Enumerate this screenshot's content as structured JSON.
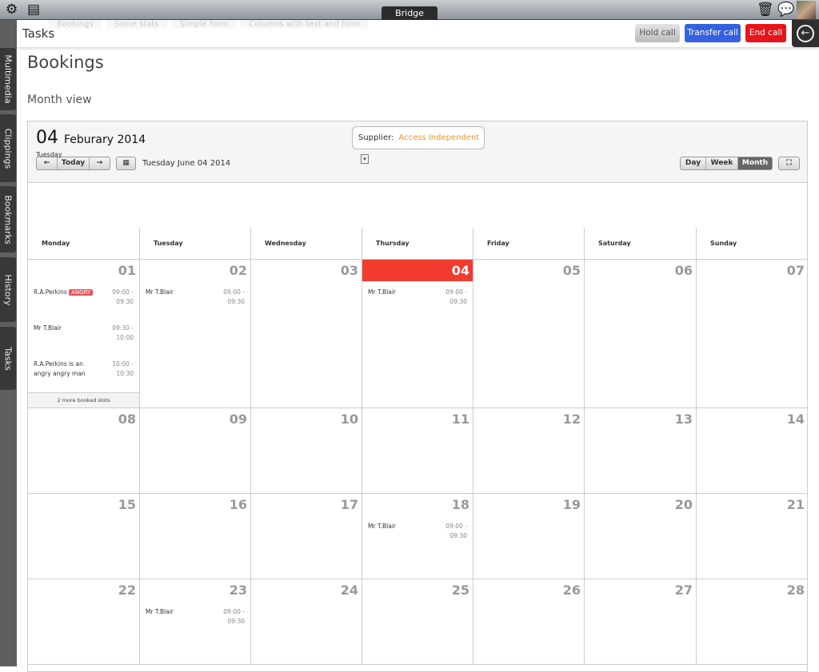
{
  "topbar": {
    "title": "Bridge",
    "icons": [
      "gear-icon",
      "notes-icon",
      "trash-icon",
      "speech-bubble-icon",
      "user-avatar"
    ]
  },
  "sidebar": {
    "tabs": [
      "Multimedia",
      "Clippings",
      "Bookmarks",
      "History",
      "Tasks"
    ]
  },
  "header": {
    "title": "Tasks",
    "ghost_tabs": [
      "Bookings",
      "Some stats",
      "Simple form",
      "Columns with text and form"
    ],
    "hold": "Hold call",
    "transfer": "Transfer call",
    "end": "End call",
    "back_icon": "back-arrow-icon"
  },
  "page": {
    "title": "Bookings",
    "subtitle": "Month view"
  },
  "toolbar": {
    "supplier_label": "Supplier:",
    "supplier_value": "Access Independent",
    "today": "Today",
    "current_date": "Tuesday June 04 2014",
    "views": [
      "Day",
      "Week",
      "Month"
    ],
    "active_view": "Month",
    "colors": {
      "supplier": "#f7941d",
      "today": "#f13b2f"
    }
  },
  "dayheader": {
    "day": "04",
    "month": "Feburary 2014",
    "weekday": "Tuesday"
  },
  "weekdays": [
    "Monday",
    "Tuesday",
    "Wednesday",
    "Thursday",
    "Friday",
    "Saturday",
    "Sunday"
  ],
  "weeks": [
    [
      {
        "d": "01",
        "events": [
          {
            "name": "R.A.Perkins",
            "badge": "ANGRY",
            "time": "09:00 - 09:30"
          },
          {
            "name": "Mr T.Blair",
            "time": "09:30 - 10:00"
          },
          {
            "name": "R.A.Perkins is an angry angry man",
            "time": "10:00 - 10:30"
          }
        ],
        "more": "2 more booked slots"
      },
      {
        "d": "02",
        "events": [
          {
            "name": "Mr T.Blair",
            "time": "09:00 - 09:30"
          }
        ]
      },
      {
        "d": "03"
      },
      {
        "d": "04",
        "today": true,
        "events": [
          {
            "name": "Mr T.Blair",
            "time": "09:00 - 09:30"
          }
        ]
      },
      {
        "d": "05"
      },
      {
        "d": "06"
      },
      {
        "d": "07"
      }
    ],
    [
      {
        "d": "08"
      },
      {
        "d": "09"
      },
      {
        "d": "10"
      },
      {
        "d": "11"
      },
      {
        "d": "12"
      },
      {
        "d": "13"
      },
      {
        "d": "14"
      }
    ],
    [
      {
        "d": "15"
      },
      {
        "d": "16"
      },
      {
        "d": "17"
      },
      {
        "d": "18",
        "events": [
          {
            "name": "Mr T.Blair",
            "time": "09:00 - 09:30"
          }
        ]
      },
      {
        "d": "19"
      },
      {
        "d": "20"
      },
      {
        "d": "21"
      }
    ],
    [
      {
        "d": "22"
      },
      {
        "d": "23",
        "events": [
          {
            "name": "Mr T.Blair",
            "time": "09:00 - 09:30"
          }
        ]
      },
      {
        "d": "24"
      },
      {
        "d": "25"
      },
      {
        "d": "26"
      },
      {
        "d": "27"
      },
      {
        "d": "28"
      }
    ]
  ]
}
